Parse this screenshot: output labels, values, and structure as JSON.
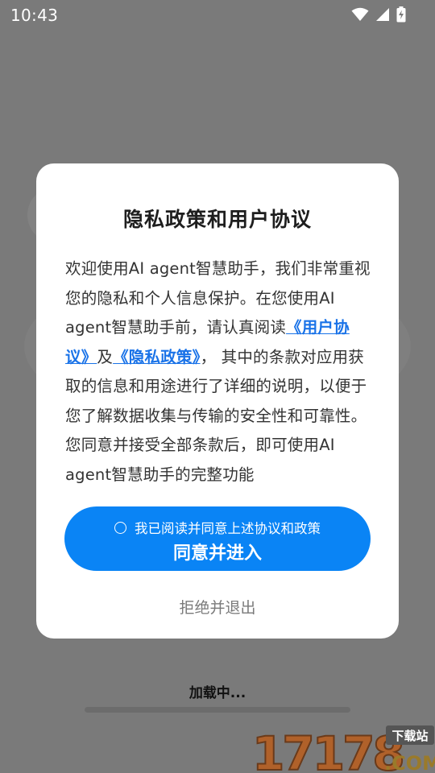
{
  "status_bar": {
    "time": "10:43",
    "icons": [
      "wifi-icon",
      "signal-icon",
      "battery-charging-icon"
    ]
  },
  "dialog": {
    "title": "隐私政策和用户协议",
    "body": {
      "intro": "欢迎使用AI agent智慧助手，我们非常重视您的隐私和个人信息保护。在您使用AI agent智慧助手前，请认真阅读",
      "link_user_agreement": "《用户协议》",
      "conjunction": "及",
      "link_privacy_policy": "《隐私政策》",
      "outro": "， 其中的条款对应用获取的信息和用途进行了详细的说明，以便于您了解数据收集与传输的安全性和可靠性。您同意并接受全部条款后，即可使用AI agent智慧助手的完整功能"
    },
    "agree_checkbox_label": "我已阅读并同意上述协议和政策",
    "agree_button_label": "同意并进入",
    "reject_label": "拒绝并退出"
  },
  "loading": {
    "text": "加载中..."
  },
  "watermark": {
    "number": "17178",
    "badge": "下载站",
    "suffix": ".COM"
  },
  "colors": {
    "scrim": "#7a7a7a",
    "primary": "#0a84f5",
    "link": "#1a73e8"
  }
}
